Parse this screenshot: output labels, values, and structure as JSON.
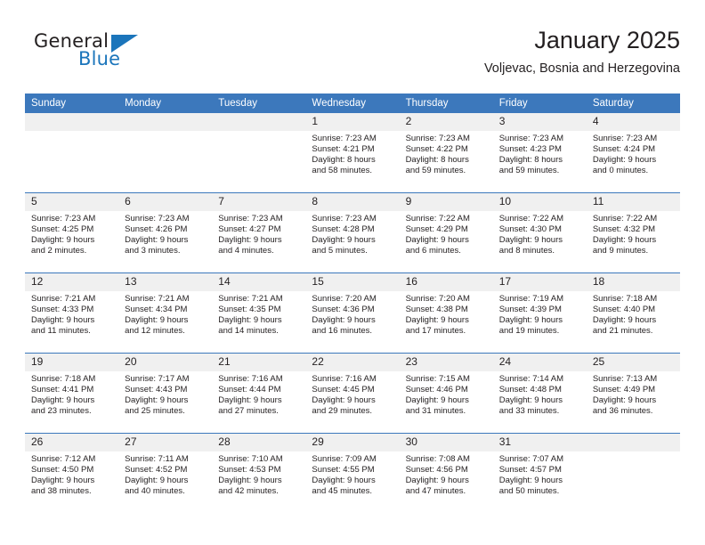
{
  "brand": {
    "name_part1": "General",
    "name_part2": "Blue",
    "triangle_color": "#1b75bb"
  },
  "header": {
    "title": "January 2025",
    "subtitle": "Voljevac, Bosnia and Herzegovina"
  },
  "theme": {
    "header_blue": "#3c78bc",
    "daynum_band": "#f0f0f0",
    "text": "#231f20"
  },
  "weekday_headers": [
    "Sunday",
    "Monday",
    "Tuesday",
    "Wednesday",
    "Thursday",
    "Friday",
    "Saturday"
  ],
  "weeks": [
    [
      {
        "day": "",
        "empty": true
      },
      {
        "day": "",
        "empty": true
      },
      {
        "day": "",
        "empty": true
      },
      {
        "day": "1",
        "sunrise": "Sunrise: 7:23 AM",
        "sunset": "Sunset: 4:21 PM",
        "daylight1": "Daylight: 8 hours",
        "daylight2": "and 58 minutes."
      },
      {
        "day": "2",
        "sunrise": "Sunrise: 7:23 AM",
        "sunset": "Sunset: 4:22 PM",
        "daylight1": "Daylight: 8 hours",
        "daylight2": "and 59 minutes."
      },
      {
        "day": "3",
        "sunrise": "Sunrise: 7:23 AM",
        "sunset": "Sunset: 4:23 PM",
        "daylight1": "Daylight: 8 hours",
        "daylight2": "and 59 minutes."
      },
      {
        "day": "4",
        "sunrise": "Sunrise: 7:23 AM",
        "sunset": "Sunset: 4:24 PM",
        "daylight1": "Daylight: 9 hours",
        "daylight2": "and 0 minutes."
      }
    ],
    [
      {
        "day": "5",
        "sunrise": "Sunrise: 7:23 AM",
        "sunset": "Sunset: 4:25 PM",
        "daylight1": "Daylight: 9 hours",
        "daylight2": "and 2 minutes."
      },
      {
        "day": "6",
        "sunrise": "Sunrise: 7:23 AM",
        "sunset": "Sunset: 4:26 PM",
        "daylight1": "Daylight: 9 hours",
        "daylight2": "and 3 minutes."
      },
      {
        "day": "7",
        "sunrise": "Sunrise: 7:23 AM",
        "sunset": "Sunset: 4:27 PM",
        "daylight1": "Daylight: 9 hours",
        "daylight2": "and 4 minutes."
      },
      {
        "day": "8",
        "sunrise": "Sunrise: 7:23 AM",
        "sunset": "Sunset: 4:28 PM",
        "daylight1": "Daylight: 9 hours",
        "daylight2": "and 5 minutes."
      },
      {
        "day": "9",
        "sunrise": "Sunrise: 7:22 AM",
        "sunset": "Sunset: 4:29 PM",
        "daylight1": "Daylight: 9 hours",
        "daylight2": "and 6 minutes."
      },
      {
        "day": "10",
        "sunrise": "Sunrise: 7:22 AM",
        "sunset": "Sunset: 4:30 PM",
        "daylight1": "Daylight: 9 hours",
        "daylight2": "and 8 minutes."
      },
      {
        "day": "11",
        "sunrise": "Sunrise: 7:22 AM",
        "sunset": "Sunset: 4:32 PM",
        "daylight1": "Daylight: 9 hours",
        "daylight2": "and 9 minutes."
      }
    ],
    [
      {
        "day": "12",
        "sunrise": "Sunrise: 7:21 AM",
        "sunset": "Sunset: 4:33 PM",
        "daylight1": "Daylight: 9 hours",
        "daylight2": "and 11 minutes."
      },
      {
        "day": "13",
        "sunrise": "Sunrise: 7:21 AM",
        "sunset": "Sunset: 4:34 PM",
        "daylight1": "Daylight: 9 hours",
        "daylight2": "and 12 minutes."
      },
      {
        "day": "14",
        "sunrise": "Sunrise: 7:21 AM",
        "sunset": "Sunset: 4:35 PM",
        "daylight1": "Daylight: 9 hours",
        "daylight2": "and 14 minutes."
      },
      {
        "day": "15",
        "sunrise": "Sunrise: 7:20 AM",
        "sunset": "Sunset: 4:36 PM",
        "daylight1": "Daylight: 9 hours",
        "daylight2": "and 16 minutes."
      },
      {
        "day": "16",
        "sunrise": "Sunrise: 7:20 AM",
        "sunset": "Sunset: 4:38 PM",
        "daylight1": "Daylight: 9 hours",
        "daylight2": "and 17 minutes."
      },
      {
        "day": "17",
        "sunrise": "Sunrise: 7:19 AM",
        "sunset": "Sunset: 4:39 PM",
        "daylight1": "Daylight: 9 hours",
        "daylight2": "and 19 minutes."
      },
      {
        "day": "18",
        "sunrise": "Sunrise: 7:18 AM",
        "sunset": "Sunset: 4:40 PM",
        "daylight1": "Daylight: 9 hours",
        "daylight2": "and 21 minutes."
      }
    ],
    [
      {
        "day": "19",
        "sunrise": "Sunrise: 7:18 AM",
        "sunset": "Sunset: 4:41 PM",
        "daylight1": "Daylight: 9 hours",
        "daylight2": "and 23 minutes."
      },
      {
        "day": "20",
        "sunrise": "Sunrise: 7:17 AM",
        "sunset": "Sunset: 4:43 PM",
        "daylight1": "Daylight: 9 hours",
        "daylight2": "and 25 minutes."
      },
      {
        "day": "21",
        "sunrise": "Sunrise: 7:16 AM",
        "sunset": "Sunset: 4:44 PM",
        "daylight1": "Daylight: 9 hours",
        "daylight2": "and 27 minutes."
      },
      {
        "day": "22",
        "sunrise": "Sunrise: 7:16 AM",
        "sunset": "Sunset: 4:45 PM",
        "daylight1": "Daylight: 9 hours",
        "daylight2": "and 29 minutes."
      },
      {
        "day": "23",
        "sunrise": "Sunrise: 7:15 AM",
        "sunset": "Sunset: 4:46 PM",
        "daylight1": "Daylight: 9 hours",
        "daylight2": "and 31 minutes."
      },
      {
        "day": "24",
        "sunrise": "Sunrise: 7:14 AM",
        "sunset": "Sunset: 4:48 PM",
        "daylight1": "Daylight: 9 hours",
        "daylight2": "and 33 minutes."
      },
      {
        "day": "25",
        "sunrise": "Sunrise: 7:13 AM",
        "sunset": "Sunset: 4:49 PM",
        "daylight1": "Daylight: 9 hours",
        "daylight2": "and 36 minutes."
      }
    ],
    [
      {
        "day": "26",
        "sunrise": "Sunrise: 7:12 AM",
        "sunset": "Sunset: 4:50 PM",
        "daylight1": "Daylight: 9 hours",
        "daylight2": "and 38 minutes."
      },
      {
        "day": "27",
        "sunrise": "Sunrise: 7:11 AM",
        "sunset": "Sunset: 4:52 PM",
        "daylight1": "Daylight: 9 hours",
        "daylight2": "and 40 minutes."
      },
      {
        "day": "28",
        "sunrise": "Sunrise: 7:10 AM",
        "sunset": "Sunset: 4:53 PM",
        "daylight1": "Daylight: 9 hours",
        "daylight2": "and 42 minutes."
      },
      {
        "day": "29",
        "sunrise": "Sunrise: 7:09 AM",
        "sunset": "Sunset: 4:55 PM",
        "daylight1": "Daylight: 9 hours",
        "daylight2": "and 45 minutes."
      },
      {
        "day": "30",
        "sunrise": "Sunrise: 7:08 AM",
        "sunset": "Sunset: 4:56 PM",
        "daylight1": "Daylight: 9 hours",
        "daylight2": "and 47 minutes."
      },
      {
        "day": "31",
        "sunrise": "Sunrise: 7:07 AM",
        "sunset": "Sunset: 4:57 PM",
        "daylight1": "Daylight: 9 hours",
        "daylight2": "and 50 minutes."
      },
      {
        "day": "",
        "empty": true
      }
    ]
  ]
}
